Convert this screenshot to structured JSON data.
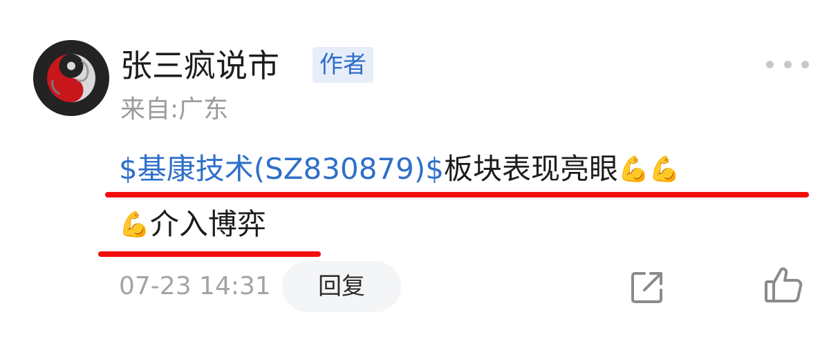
{
  "post": {
    "author": {
      "name": "张三疯说市",
      "badge": "作者",
      "location": "来自:广东"
    },
    "content": {
      "stock_link": "$基康技术(SZ830879)$",
      "line1_text": "板块表现亮眼",
      "line1_emojis": "💪💪",
      "line2_emoji": "💪",
      "line2_text": "介入博弈"
    },
    "footer": {
      "timestamp": "07-23 14:31",
      "reply_label": "回复"
    }
  },
  "icons": {
    "more": "more-dots-icon",
    "share": "share-icon",
    "like": "thumbs-up-icon"
  },
  "colors": {
    "link": "#2f6fc9",
    "badge_bg": "#e7eefa",
    "annotation_red": "#f20d0d",
    "secondary_text": "#9a9a9a"
  }
}
